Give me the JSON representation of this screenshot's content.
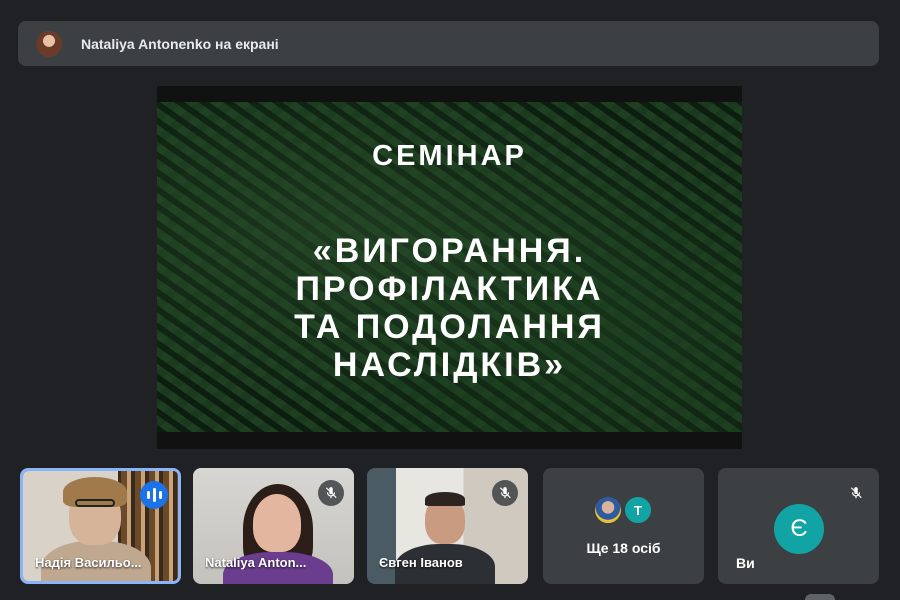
{
  "presenter_banner": {
    "text": "Nataliya Antonenko на екрані"
  },
  "slide": {
    "title": "СЕМІНАР",
    "subtitle_lines": [
      "«ВИГОРАННЯ.",
      "ПРОФІЛАКТИКА",
      "ТА ПОДОЛАННЯ",
      "НАСЛІДКІВ»"
    ]
  },
  "participants": [
    {
      "name": "Надія Васильо...",
      "status": "speaking-icon"
    },
    {
      "name": "Nataliya Anton...",
      "status": "mic-off-icon"
    },
    {
      "name": "Євген Іванов",
      "status": "mic-off-icon"
    }
  ],
  "more_tile": {
    "avatar_initial": "Т",
    "label": "Ще 18 осіб"
  },
  "self_tile": {
    "avatar_initial": "Є",
    "label": "Ви",
    "status": "mic-off-icon"
  },
  "colors": {
    "background": "#202124",
    "tile": "#3c4043",
    "active_border": "#8ab4f8",
    "speaking": "#1a73e8",
    "avatar_teal": "#12a4a4"
  }
}
